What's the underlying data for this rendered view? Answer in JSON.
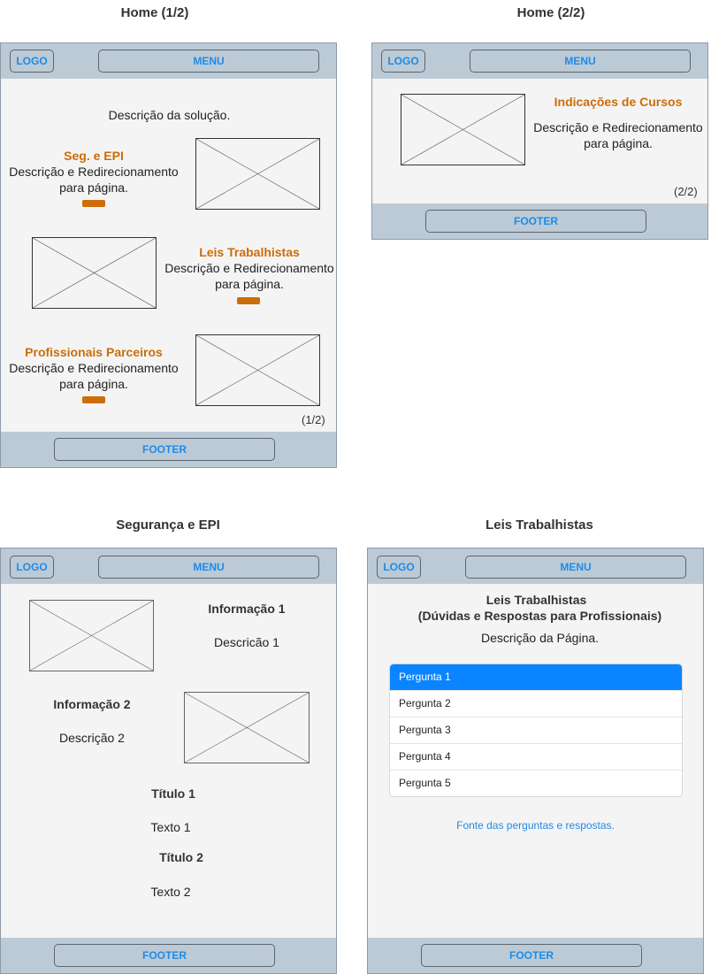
{
  "frames": {
    "home1": {
      "title": "Home (1/2)",
      "logo": "LOGO",
      "menu": "MENU",
      "footer": "FOOTER",
      "intro": "Descrição da solução.",
      "sections": [
        {
          "title": "Seg. e EPI",
          "desc1": "Descrição e Redirecionamento",
          "desc2": "para página."
        },
        {
          "title": "Leis Trabalhistas",
          "desc1": "Descrição e Redirecionamento",
          "desc2": "para página."
        },
        {
          "title": "Profissionais Parceiros",
          "desc1": "Descrição e Redirecionamento",
          "desc2": "para página."
        }
      ],
      "pager": "(1/2)"
    },
    "home2": {
      "title": "Home (2/2)",
      "logo": "LOGO",
      "menu": "MENU",
      "footer": "FOOTER",
      "section": {
        "title": "Indicações de Cursos",
        "desc1": "Descrição e Redirecionamento",
        "desc2": "para página."
      },
      "pager": "(2/2)"
    },
    "seguranca": {
      "title": "Segurança e EPI",
      "logo": "LOGO",
      "menu": "MENU",
      "footer": "FOOTER",
      "info1": {
        "title": "Informação 1",
        "desc": "Descricão 1"
      },
      "info2": {
        "title": "Informação 2",
        "desc": "Descrição 2"
      },
      "block1": {
        "title": "Título 1",
        "text": "Texto 1"
      },
      "block2": {
        "title": "Título 2",
        "text": "Texto 2"
      }
    },
    "leis": {
      "title": "Leis Trabalhistas",
      "logo": "LOGO",
      "menu": "MENU",
      "footer": "FOOTER",
      "heading1": "Leis Trabalhistas",
      "heading2": "(Dúvidas e Respostas para Profissionais)",
      "desc": "Descrição da Página.",
      "questions": [
        "Pergunta 1",
        "Pergunta 2",
        "Pergunta 3",
        "Pergunta 4",
        "Pergunta 5"
      ],
      "active_question": 0,
      "source_link": "Fonte das perguntas e respostas."
    }
  },
  "colors": {
    "accent_orange": "#cc6d08",
    "link_blue": "#1e8be8",
    "bar": "#bccad6",
    "active": "#0a84ff"
  }
}
